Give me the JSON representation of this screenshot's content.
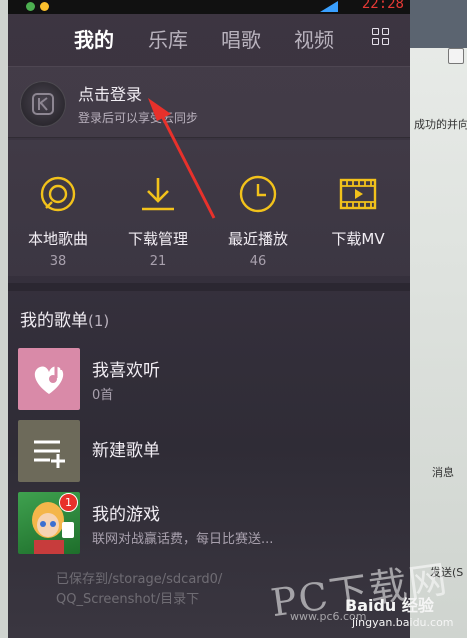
{
  "topnav": {
    "tabs": [
      {
        "label": "我的",
        "active": true
      },
      {
        "label": "乐库",
        "active": false
      },
      {
        "label": "唱歌",
        "active": false
      },
      {
        "label": "视频",
        "active": false
      }
    ]
  },
  "status": {
    "time": "22:28"
  },
  "login": {
    "title": "点击登录",
    "subtitle": "登录后可以享受云同步"
  },
  "quick": [
    {
      "label": "本地歌曲",
      "count": "38",
      "icon": "local-music-icon"
    },
    {
      "label": "下载管理",
      "count": "21",
      "icon": "download-icon"
    },
    {
      "label": "最近播放",
      "count": "46",
      "icon": "clock-icon"
    },
    {
      "label": "下载MV",
      "count": "",
      "icon": "mv-film-icon"
    }
  ],
  "playlists": {
    "heading": "我的歌单",
    "count": "(1)",
    "items": [
      {
        "title": "我喜欢听",
        "subtitle": "0首"
      },
      {
        "title": "新建歌单",
        "subtitle": ""
      },
      {
        "title": "我的游戏",
        "subtitle": "联网对战赢话费，每日比赛送...",
        "badge": "1"
      }
    ]
  },
  "toast": {
    "line1": "已保存到/storage/sdcard0/",
    "line2": "QQ_Screenshot/目录下"
  },
  "watermark": {
    "text": "PC下载网",
    "sub": "www.pc6.com",
    "baidu": "Baidu 经验",
    "baidu_url": "jingyan.baidu.com"
  },
  "background": {
    "frag1": "成功的并向·",
    "frag2": "消息",
    "frag3": "发送(S"
  },
  "colors": {
    "accent": "#f2c21b",
    "arrow": "#e8312b",
    "like": "#d98aa8",
    "newlist": "#6d6a5a"
  }
}
